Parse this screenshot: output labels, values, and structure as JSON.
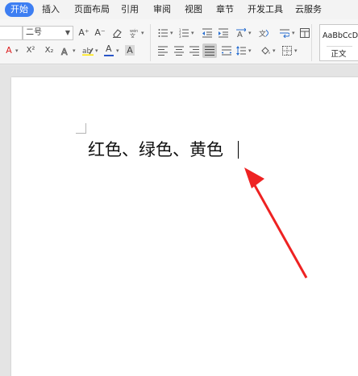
{
  "menu": {
    "tabs": [
      {
        "label": "开始",
        "active": true
      },
      {
        "label": "插入"
      },
      {
        "label": "页面布局"
      },
      {
        "label": "引用"
      },
      {
        "label": "审阅"
      },
      {
        "label": "视图"
      },
      {
        "label": "章节"
      },
      {
        "label": "开发工具"
      },
      {
        "label": "云服务"
      }
    ]
  },
  "ribbon": {
    "font_size_value": "二号",
    "grow_font_label": "A⁺",
    "shrink_font_label": "A⁻",
    "superscript_label": "X²",
    "subscript_label": "X₂",
    "font_color_label": "A",
    "char_shading_label": "A",
    "style_gallery": {
      "sample_text": "AaBbCcDd",
      "style_name": "正文"
    }
  },
  "document": {
    "body_text": "红色、绿色、黄色"
  },
  "colors": {
    "accent": "#3d7ef2",
    "annotation_arrow": "#ee2222",
    "font_color_bar": "#2a55c8"
  }
}
